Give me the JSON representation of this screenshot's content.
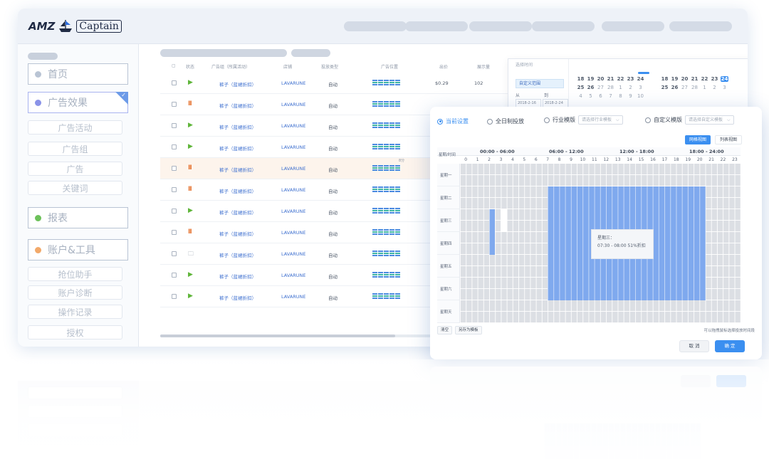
{
  "brand": {
    "amz": "AMZ",
    "captain": "Captain"
  },
  "sidebar": {
    "main_items": [
      {
        "label": "首页",
        "dot_color": "#b9c4d4"
      },
      {
        "label": "广告效果",
        "dot_color": "#8a93e8",
        "active": true
      }
    ],
    "ad_sub": [
      "广告活动",
      "广告组",
      "广告",
      "关键词"
    ],
    "report": {
      "label": "报表",
      "dot_color": "#6cc15a"
    },
    "account": {
      "label": "账户&工具",
      "dot_color": "#f2a96a"
    },
    "account_sub": [
      "抢位助手",
      "账户诊断",
      "操作记录",
      "授权"
    ]
  },
  "table": {
    "headers": [
      "状态",
      "广告组（所属活动）",
      "店铺",
      "投放类型",
      "广告位置",
      "出价",
      "展示量"
    ],
    "rows": [
      {
        "status": "play",
        "name": "裤子（蓝裙折扣）",
        "shop": "LAVARUNE",
        "type": "自动",
        "bid": "$0.29",
        "val": "102"
      },
      {
        "status": "pause",
        "name": "裤子（蓝裙折扣）",
        "shop": "LAVARUNE",
        "type": "自动",
        "bid": "",
        "val": ""
      },
      {
        "status": "play",
        "name": "裤子（蓝裙折扣）",
        "shop": "LAVARUNE",
        "type": "自动",
        "bid": "",
        "val": ""
      },
      {
        "status": "play",
        "name": "裤子（蓝裙折扣）",
        "shop": "LAVARUNE",
        "type": "自动",
        "bid": "",
        "val": ""
      },
      {
        "status": "pause",
        "name": "裤子（蓝裙折扣）",
        "shop": "LAVARUNE",
        "type": "自动",
        "bid": "",
        "val": "",
        "highlight": true,
        "tag": "8分"
      },
      {
        "status": "pause",
        "name": "裤子（蓝裙折扣）",
        "shop": "LAVARUNE",
        "type": "自动",
        "bid": "",
        "val": ""
      },
      {
        "status": "play",
        "name": "裤子（蓝裙折扣）",
        "shop": "LAVARUNE",
        "type": "自动",
        "bid": "",
        "val": ""
      },
      {
        "status": "pause",
        "name": "裤子（蓝裙折扣）",
        "shop": "LAVARUNE",
        "type": "自动",
        "bid": "",
        "val": ""
      },
      {
        "status": "folder",
        "name": "裤子（蓝裙折扣）",
        "shop": "LAVARUNE",
        "type": "自动",
        "bid": "",
        "val": ""
      },
      {
        "status": "play",
        "name": "裤子（蓝裙折扣）",
        "shop": "LAVARUNE",
        "type": "自动",
        "bid": "",
        "val": ""
      },
      {
        "status": "play",
        "name": "裤子（蓝裙折扣）",
        "shop": "LAVARUNE",
        "type": "自动",
        "bid": "",
        "val": ""
      }
    ]
  },
  "date_popup": {
    "caption": "选择时间",
    "option": "自定义范围",
    "from_label": "从",
    "to_label": "到",
    "from_value": "2018-2-16",
    "to_value": "2018-2-24",
    "cal1": [
      [
        "18",
        "19",
        "20",
        "21",
        "22",
        "23",
        "24"
      ],
      [
        "25",
        "26",
        "27",
        "28",
        "1",
        "2",
        "3"
      ],
      [
        "4",
        "5",
        "6",
        "7",
        "8",
        "9",
        "10"
      ]
    ],
    "cal2": [
      [
        "18",
        "19",
        "20",
        "21",
        "22",
        "23",
        "24"
      ],
      [
        "25",
        "26",
        "27",
        "28",
        "1",
        "2",
        "3"
      ]
    ],
    "cal2_selected": "24"
  },
  "modal": {
    "options": {
      "current": "当前设置",
      "all_day": "全日制投放",
      "industry": "行业模版",
      "industry_placeholder": "请选择行业模板",
      "custom": "自定义模版",
      "custom_placeholder": "请选择自定义模板"
    },
    "views": {
      "grid": "网格视图",
      "list": "列表视图"
    },
    "corner_label": "星期/时间",
    "ranges": [
      "00:00 - 06:00",
      "06:00 - 12:00",
      "12:00 - 18:00",
      "18:00 - 24:00"
    ],
    "hours": [
      "0",
      "1",
      "2",
      "3",
      "4",
      "5",
      "6",
      "7",
      "8",
      "9",
      "10",
      "11",
      "12",
      "13",
      "14",
      "15",
      "16",
      "17",
      "18",
      "19",
      "20",
      "21",
      "22",
      "23"
    ],
    "days": [
      "星期一",
      "星期二",
      "星期三",
      "星期四",
      "星期五",
      "星期六",
      "星期天"
    ],
    "tooltip": {
      "line1": "星期三：",
      "line2": "07:30 - 08:00  51%折扣"
    },
    "clear": "清空",
    "save_template": "另存为模板",
    "hint": "可以拖拽鼠标选择投放时间段",
    "cancel": "取 消",
    "confirm": "确 定"
  },
  "colors": {
    "accent": "#3b8ff0",
    "block": "#7fa9ee",
    "play": "#5fb53a",
    "pause": "#e67432"
  }
}
